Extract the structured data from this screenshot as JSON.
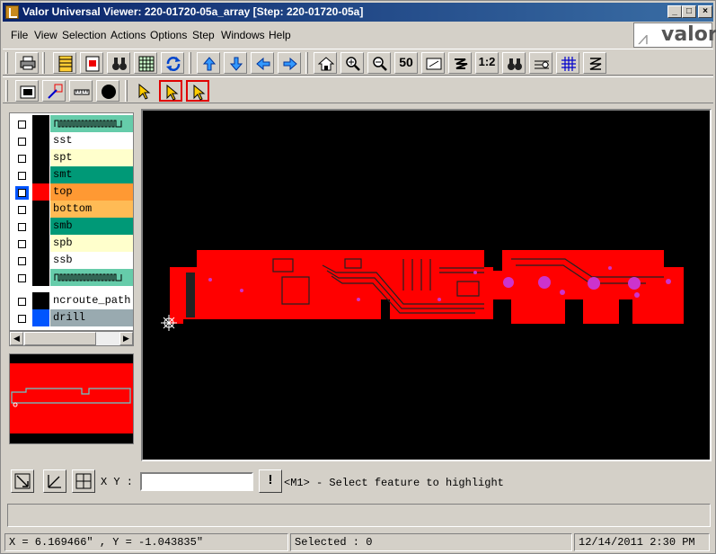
{
  "window": {
    "title": "Valor Universal Viewer: 220-01720-05a_array [Step: 220-01720-05a]",
    "minimize": "_",
    "maximize": "□",
    "close": "×"
  },
  "menu": [
    "File",
    "View",
    "Selection",
    "Actions",
    "Options",
    "Step",
    "Windows",
    "Help"
  ],
  "logo": {
    "text": "valor",
    "mark": "⩘"
  },
  "toolbar1_icons": [
    "print-icon",
    "layers-list-icon",
    "step-icon",
    "binoculars-icon",
    "table-icon",
    "refresh-icon",
    "pan-up-icon",
    "pan-down-icon",
    "pan-left-icon",
    "pan-right-icon",
    "home-icon",
    "zoom-in-icon",
    "zoom-out-icon",
    "zoom-fit-icon",
    "zoom-box-icon",
    "zoom-profile-icon",
    "zoom-1to1-icon",
    "find-icon",
    "measure-icon",
    "grid-icon",
    "snap-icon"
  ],
  "toolbar1_labels": {
    "fit": "50",
    "one_to_one": "1:2"
  },
  "toolbar2_icons": [
    "fill-icon",
    "outline-icon",
    "ruler-icon",
    "circle-icon",
    "select-arrow-icon",
    "select-highlight-icon",
    "select-window-icon"
  ],
  "layers": [
    {
      "name": "",
      "color": "#66ccaa",
      "selected": false,
      "pattern": true
    },
    {
      "name": "sst",
      "color": "#ffffff",
      "selected": false
    },
    {
      "name": "spt",
      "color": "#ffffcc",
      "selected": false
    },
    {
      "name": "smt",
      "color": "#009977",
      "selected": false
    },
    {
      "name": "top",
      "color": "#ff9933",
      "selected": true
    },
    {
      "name": "bottom",
      "color": "#ffbb55",
      "selected": false
    },
    {
      "name": "smb",
      "color": "#009977",
      "selected": false
    },
    {
      "name": "spb",
      "color": "#ffffcc",
      "selected": false
    },
    {
      "name": "ssb",
      "color": "#ffffff",
      "selected": false
    },
    {
      "name": "",
      "color": "#66ccaa",
      "selected": false,
      "pattern": true
    },
    {
      "name": "ncroute_path",
      "color": "#ffffff",
      "selected": false
    },
    {
      "name": "drill",
      "color": "#99aab0",
      "selected": false
    }
  ],
  "colors": {
    "canvas": "#000000",
    "board": "#ff0000",
    "selected_layer": "#ff0000",
    "drill_swatch": "#0055ff",
    "highlight": "#e00000"
  },
  "coords": {
    "label": "X Y :",
    "value": "",
    "hint": "<M1> - Select feature to highlight"
  },
  "status": {
    "position": "X = 6.169466\" , Y = -1.043835\"",
    "selected": "Selected : 0",
    "datetime": "12/14/2011  2:30 PM"
  }
}
